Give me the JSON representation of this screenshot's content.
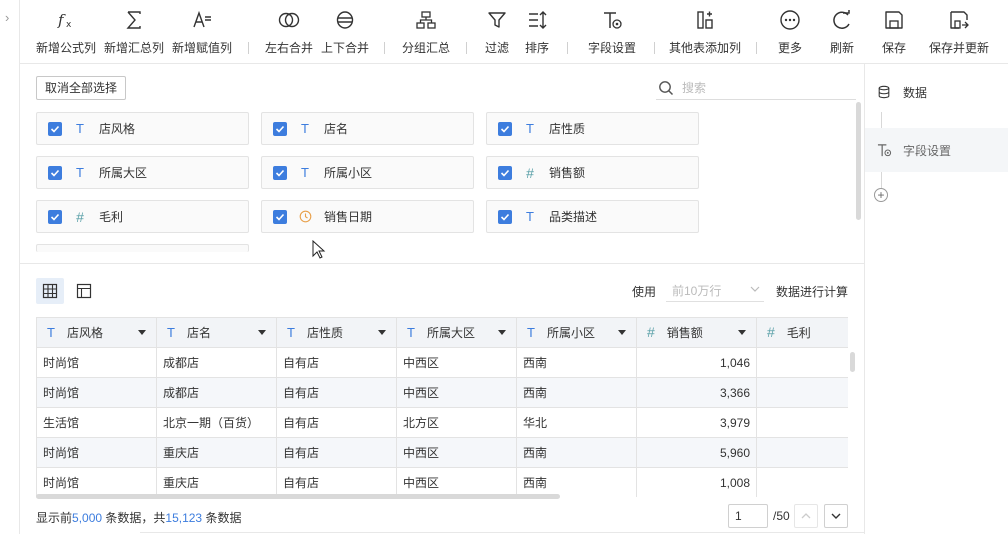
{
  "toolbar": {
    "items": [
      {
        "label": "新增公式列",
        "icon": "formula-icon"
      },
      {
        "label": "新增汇总列",
        "icon": "sigma-icon"
      },
      {
        "label": "新增赋值列",
        "icon": "assign-icon"
      },
      {
        "label": "左右合并",
        "icon": "merge-horizontal-icon"
      },
      {
        "label": "上下合并",
        "icon": "merge-vertical-icon"
      },
      {
        "label": "分组汇总",
        "icon": "group-summary-icon"
      },
      {
        "label": "过滤",
        "icon": "filter-icon"
      },
      {
        "label": "排序",
        "icon": "sort-icon"
      },
      {
        "label": "字段设置",
        "icon": "field-settings-icon"
      },
      {
        "label": "其他表添加列",
        "icon": "add-column-icon"
      },
      {
        "label": "更多",
        "icon": "more-icon"
      },
      {
        "label": "刷新",
        "icon": "refresh-icon"
      },
      {
        "label": "保存",
        "icon": "save-icon"
      },
      {
        "label": "保存并更新",
        "icon": "save-update-icon"
      }
    ]
  },
  "right_panel": {
    "items": [
      {
        "label": "数据",
        "icon": "database-icon"
      },
      {
        "label": "字段设置",
        "icon": "field-settings-icon"
      }
    ],
    "add_icon": "plus-circle-icon"
  },
  "field_area": {
    "cancel_all_label": "取消全部选择",
    "search_placeholder": "搜索",
    "fields": [
      {
        "name": "店风格",
        "type": "text",
        "checked": true
      },
      {
        "name": "店名",
        "type": "text",
        "checked": true
      },
      {
        "name": "店性质",
        "type": "text",
        "checked": true
      },
      {
        "name": "所属大区",
        "type": "text",
        "checked": true
      },
      {
        "name": "所属小区",
        "type": "text",
        "checked": true
      },
      {
        "name": "销售额",
        "type": "number",
        "checked": true
      },
      {
        "name": "毛利",
        "type": "number",
        "checked": true
      },
      {
        "name": "销售日期",
        "type": "date",
        "checked": true
      },
      {
        "name": "品类描述",
        "type": "text",
        "checked": true
      }
    ]
  },
  "preview": {
    "use_label": "使用",
    "row_option": "前10万行",
    "calc_label": "数据进行计算",
    "columns": [
      {
        "name": "店风格",
        "type": "text"
      },
      {
        "name": "店名",
        "type": "text"
      },
      {
        "name": "店性质",
        "type": "text"
      },
      {
        "name": "所属大区",
        "type": "text"
      },
      {
        "name": "所属小区",
        "type": "text"
      },
      {
        "name": "销售额",
        "type": "number"
      },
      {
        "name": "毛利",
        "type": "number"
      }
    ],
    "rows": [
      [
        "时尚馆",
        "成都店",
        "自有店",
        "中西区",
        "西南",
        "1,046",
        ""
      ],
      [
        "时尚馆",
        "成都店",
        "自有店",
        "中西区",
        "西南",
        "3,366",
        ""
      ],
      [
        "生活馆",
        "北京一期（百货）",
        "自有店",
        "北方区",
        "华北",
        "3,979",
        ""
      ],
      [
        "时尚馆",
        "重庆店",
        "自有店",
        "中西区",
        "西南",
        "5,960",
        ""
      ],
      [
        "时尚馆",
        "重庆店",
        "自有店",
        "中西区",
        "西南",
        "1,008",
        ""
      ]
    ]
  },
  "footer": {
    "prefix": "显示前",
    "shown_count": "5,000",
    "middle": "条数据，共",
    "total_count": "15,123",
    "suffix": "条数据",
    "page_value": "1",
    "page_total": "/50"
  },
  "colors": {
    "accent": "#3d7dde",
    "number_type": "#5aa0a8",
    "date_type": "#e8a04a"
  }
}
